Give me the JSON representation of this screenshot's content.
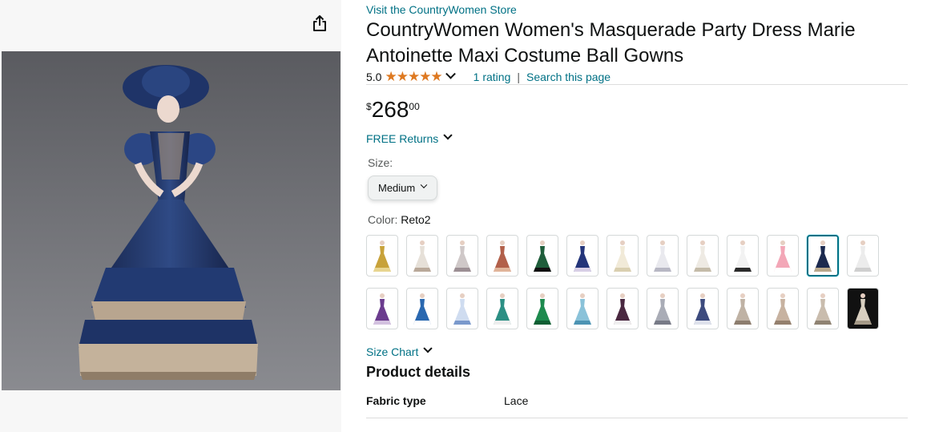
{
  "product": {
    "store_link": "Visit the CountryWomen Store",
    "title": "CountryWomen Women's Masquerade Party Dress Marie Antoinette Maxi Costume Ball Gowns",
    "rating_value": "5.0",
    "stars": "★★★★★",
    "rating_count": "1 rating",
    "separator": "|",
    "search_page": "Search this page"
  },
  "price": {
    "symbol": "$",
    "whole": "268",
    "fraction": "00"
  },
  "returns_label": "FREE Returns",
  "size": {
    "label": "Size:",
    "selected": "Medium"
  },
  "color": {
    "label": "Color: ",
    "selected": "Reto2"
  },
  "swatch_rows": [
    [
      {
        "name": "gold-gown",
        "dress": "#c8a23a",
        "trim": "#e8d590"
      },
      {
        "name": "ivory-hat-gown",
        "dress": "#e6e0d8",
        "trim": "#b9a99a"
      },
      {
        "name": "grey-gown",
        "dress": "#cfc8c8",
        "trim": "#9c8f94"
      },
      {
        "name": "rust-gown",
        "dress": "#b2604a",
        "trim": "#e0b49a"
      },
      {
        "name": "green-black-gown",
        "dress": "#1f5e3b",
        "trim": "#111111"
      },
      {
        "name": "navy-gown",
        "dress": "#24357a",
        "trim": "#d8cfe6"
      },
      {
        "name": "cream-gown",
        "dress": "#f1ead8",
        "trim": "#d9cfb0"
      },
      {
        "name": "white-lace-gown",
        "dress": "#e9e9ee",
        "trim": "#b8b8c4"
      },
      {
        "name": "ivory-lace-gown",
        "dress": "#eeeae3",
        "trim": "#c4bba9"
      },
      {
        "name": "white-black-floral-gown",
        "dress": "#f2f2f2",
        "trim": "#2b2b2b"
      },
      {
        "name": "pink-gown",
        "dress": "#f3a7b7",
        "trim": "#ffffff"
      },
      {
        "name": "reto2-navy-gown",
        "dress": "#1c2a4f",
        "trim": "#b9a88c",
        "selected": true
      },
      {
        "name": "white-gown",
        "dress": "#ececec",
        "trim": "#cfcfcf"
      }
    ],
    [
      {
        "name": "purple-gown",
        "dress": "#6b3c8e",
        "trim": "#d4c2e0"
      },
      {
        "name": "blue-white-gown",
        "dress": "#2a68b0",
        "trim": "#ffffff"
      },
      {
        "name": "blue-floral-gown",
        "dress": "#cfdcf0",
        "trim": "#7a99cc"
      },
      {
        "name": "teal-white-gown",
        "dress": "#2c8f84",
        "trim": "#eeeeee"
      },
      {
        "name": "emerald-gown",
        "dress": "#1d8a4e",
        "trim": "#0f5e33"
      },
      {
        "name": "aqua-gown",
        "dress": "#8ac2d9",
        "trim": "#4d94b3"
      },
      {
        "name": "plum-black-gown",
        "dress": "#4a2840",
        "trim": "#f0f0f0"
      },
      {
        "name": "silver-gown",
        "dress": "#a9acb6",
        "trim": "#777a86"
      },
      {
        "name": "navy-white-gown",
        "dress": "#3d4b7e",
        "trim": "#dfe2ec"
      },
      {
        "name": "beige-gown",
        "dress": "#bfb2a4",
        "trim": "#8c7d6e"
      },
      {
        "name": "taupe-gown",
        "dress": "#c7b2a0",
        "trim": "#94806e"
      },
      {
        "name": "sand-gown",
        "dress": "#c9bcad",
        "trim": "#8f8373"
      },
      {
        "name": "dark-photo-gown",
        "dress": "#d8cfc0",
        "trim": "#a59a88",
        "dark": true
      }
    ]
  ],
  "size_chart_label": "Size Chart",
  "product_details": {
    "heading": "Product details",
    "rows": [
      {
        "label": "Fabric type",
        "value": "Lace"
      }
    ]
  },
  "icons": {
    "share": "share-icon",
    "chevron": "chevron-down-icon"
  },
  "colors": {
    "link": "#007185",
    "star": "#de7921",
    "selected_border": "#007185"
  }
}
